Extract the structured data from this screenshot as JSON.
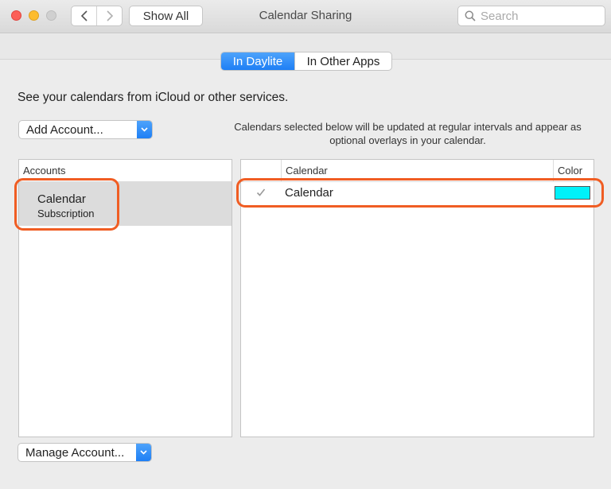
{
  "window": {
    "title": "Calendar Sharing",
    "show_all_label": "Show All",
    "search_placeholder": "Search"
  },
  "tabs": [
    {
      "label": "In Daylite",
      "selected": true
    },
    {
      "label": "In Other Apps",
      "selected": false
    }
  ],
  "intro_text": "See your calendars from iCloud or other services.",
  "add_account": {
    "label": "Add Account..."
  },
  "help_text": "Calendars selected below will be updated at regular intervals and appear as optional overlays in your calendar.",
  "accounts": {
    "header": "Accounts",
    "items": [
      {
        "name": "Calendar",
        "type": "Subscription",
        "selected": true
      }
    ]
  },
  "calendars": {
    "headers": {
      "calendar": "Calendar",
      "color": "Color"
    },
    "rows": [
      {
        "name": "Calendar",
        "checked": true,
        "color": "#00f1f9"
      }
    ]
  },
  "manage_account": {
    "label": "Manage Account..."
  },
  "colors": {
    "accent": "#1e7ff5",
    "highlight": "#f05d23",
    "selection": "#dcdcdc"
  }
}
